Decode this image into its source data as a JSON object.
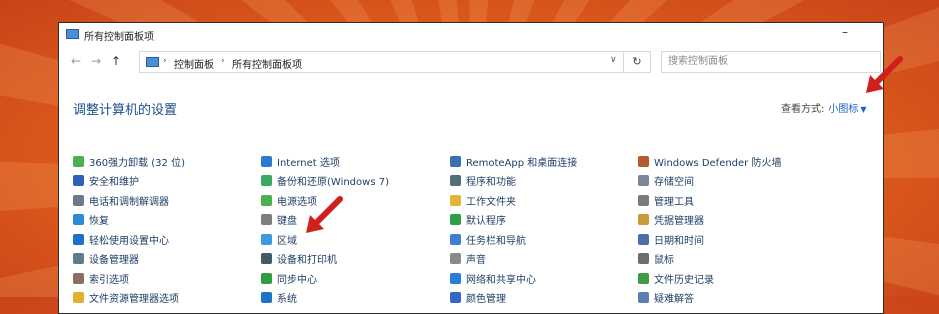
{
  "window": {
    "title": "所有控制面板项",
    "minimize_glyph": "–"
  },
  "address": {
    "back_glyph": "←",
    "forward_glyph": "→",
    "up_glyph": "↑",
    "sep": "›",
    "crumbs": [
      "控制面板",
      "所有控制面板项"
    ],
    "dropdown_glyph": "∨",
    "refresh_glyph": "↻",
    "search_placeholder": "搜索控制面板"
  },
  "main": {
    "heading": "调整计算机的设置",
    "view_by_label": "查看方式:",
    "view_by_value": "小图标",
    "view_by_caret": "▼"
  },
  "columns": [
    {
      "items": [
        {
          "label": "360强力卸载 (32 位)",
          "icon": "uninstall-icon",
          "color": "#4caf50"
        },
        {
          "label": "安全和维护",
          "icon": "flag-icon",
          "color": "#2a62b8"
        },
        {
          "label": "电话和调制解调器",
          "icon": "phone-icon",
          "color": "#6c7a89"
        },
        {
          "label": "恢复",
          "icon": "recovery-icon",
          "color": "#2d8bd4"
        },
        {
          "label": "轻松使用设置中心",
          "icon": "accessibility-icon",
          "color": "#1e6fc9"
        },
        {
          "label": "设备管理器",
          "icon": "device-manager-icon",
          "color": "#607d8b"
        },
        {
          "label": "索引选项",
          "icon": "indexing-icon",
          "color": "#8d6e63"
        },
        {
          "label": "文件资源管理器选项",
          "icon": "folder-options-icon",
          "color": "#e0b030"
        }
      ]
    },
    {
      "items": [
        {
          "label": "Internet 选项",
          "icon": "internet-icon",
          "color": "#2c7bd1"
        },
        {
          "label": "备份和还原(Windows 7)",
          "icon": "backup-icon",
          "color": "#3aa860"
        },
        {
          "label": "电源选项",
          "icon": "power-icon",
          "color": "#4caf50"
        },
        {
          "label": "键盘",
          "icon": "keyboard-icon",
          "color": "#7d7d7d"
        },
        {
          "label": "区域",
          "icon": "region-icon",
          "color": "#3b9be0"
        },
        {
          "label": "设备和打印机",
          "icon": "printer-icon",
          "color": "#455a64"
        },
        {
          "label": "同步中心",
          "icon": "sync-icon",
          "color": "#2e9e3e"
        },
        {
          "label": "系统",
          "icon": "system-icon",
          "color": "#1e73c8"
        }
      ]
    },
    {
      "items": [
        {
          "label": "RemoteApp 和桌面连接",
          "icon": "remoteapp-icon",
          "color": "#3a6fb0"
        },
        {
          "label": "程序和功能",
          "icon": "programs-icon",
          "color": "#546e7a"
        },
        {
          "label": "工作文件夹",
          "icon": "work-folders-icon",
          "color": "#e2b43a"
        },
        {
          "label": "默认程序",
          "icon": "default-programs-icon",
          "color": "#2f9e47"
        },
        {
          "label": "任务栏和导航",
          "icon": "taskbar-icon",
          "color": "#3f7fcf"
        },
        {
          "label": "声音",
          "icon": "sound-icon",
          "color": "#8a8a8a"
        },
        {
          "label": "网络和共享中心",
          "icon": "network-icon",
          "color": "#2b7ed6"
        },
        {
          "label": "颜色管理",
          "icon": "color-management-icon",
          "color": "#3567c9"
        }
      ]
    },
    {
      "items": [
        {
          "label": "Windows Defender 防火墙",
          "icon": "firewall-icon",
          "color": "#b55a2c"
        },
        {
          "label": "存储空间",
          "icon": "storage-icon",
          "color": "#7b8794"
        },
        {
          "label": "管理工具",
          "icon": "admin-tools-icon",
          "color": "#7a7a7a"
        },
        {
          "label": "凭据管理器",
          "icon": "credential-icon",
          "color": "#c79a3b"
        },
        {
          "label": "日期和时间",
          "icon": "calendar-icon",
          "color": "#4c6fa8"
        },
        {
          "label": "鼠标",
          "icon": "mouse-icon",
          "color": "#6d6d6d"
        },
        {
          "label": "文件历史记录",
          "icon": "file-history-icon",
          "color": "#3c9d46"
        },
        {
          "label": "疑难解答",
          "icon": "troubleshoot-icon",
          "color": "#5b7fb5"
        }
      ]
    }
  ]
}
